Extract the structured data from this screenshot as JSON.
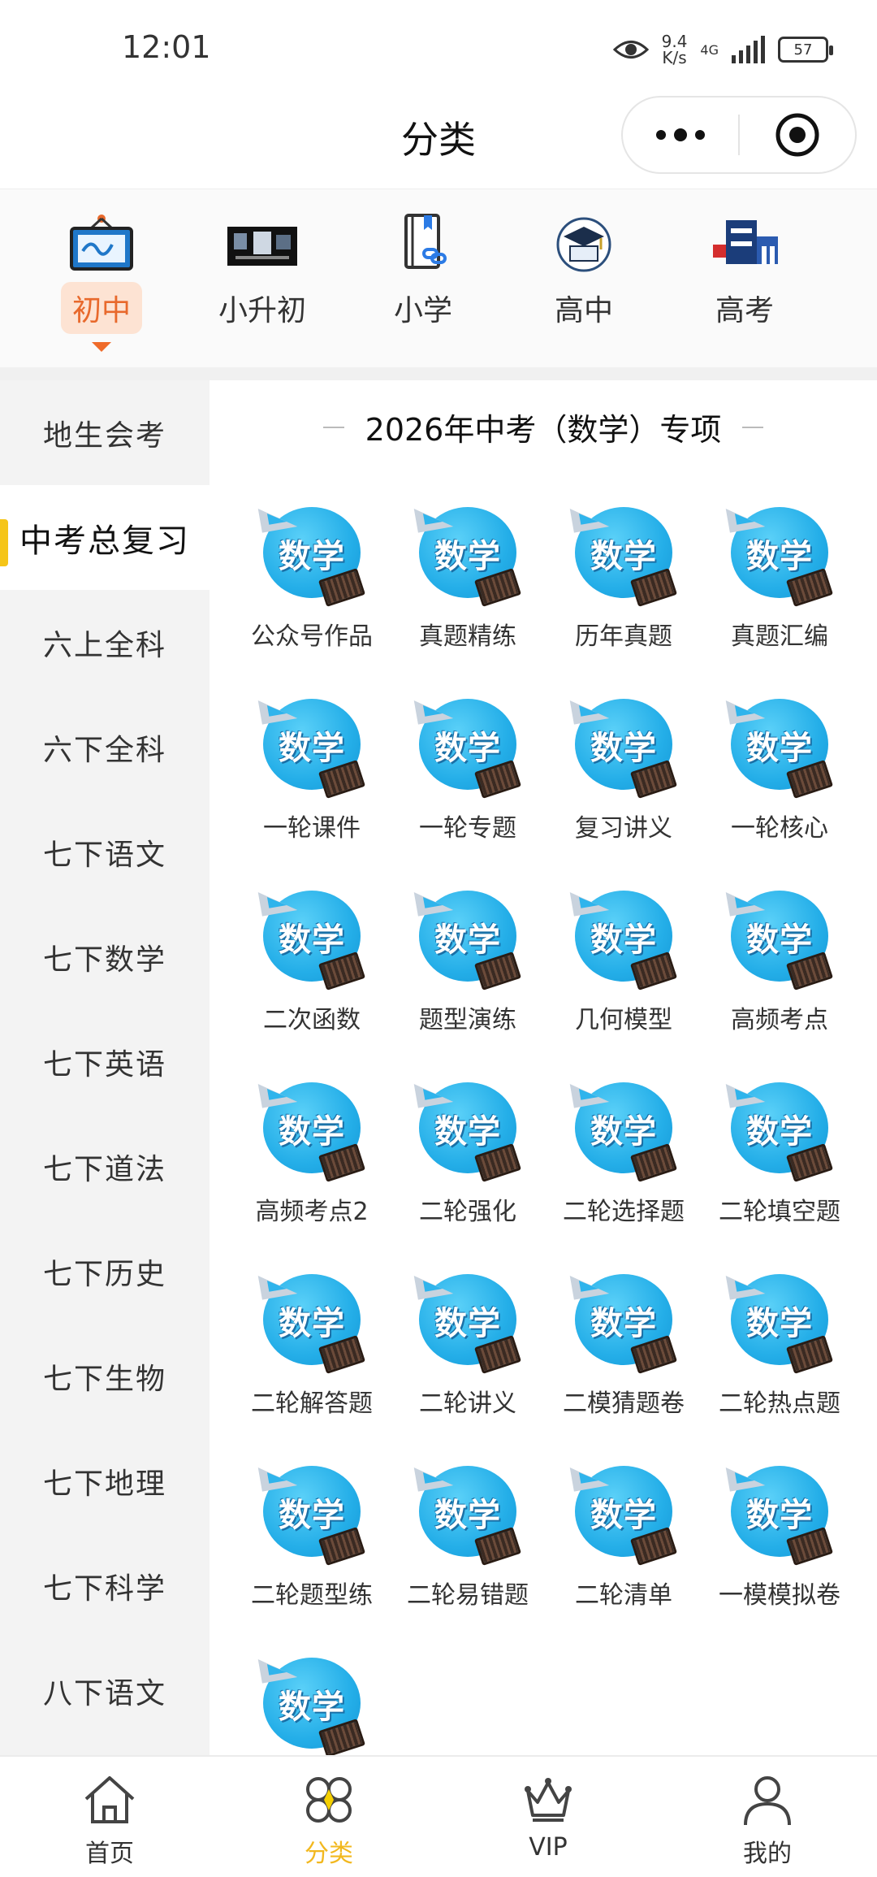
{
  "status_bar": {
    "time": "12:01",
    "net_speed_value": "9.4",
    "net_speed_unit": "K/s",
    "network_type": "4G",
    "battery": "57"
  },
  "header": {
    "title": "分类"
  },
  "levels": [
    {
      "label": "初中",
      "icon": "whiteboard-icon",
      "active": true
    },
    {
      "label": "小升初",
      "icon": "banner-image-icon",
      "active": false
    },
    {
      "label": "小学",
      "icon": "book-link-icon",
      "active": false
    },
    {
      "label": "高中",
      "icon": "graduation-cap-icon",
      "active": false
    },
    {
      "label": "高考",
      "icon": "gaokao-logo-icon",
      "active": false
    }
  ],
  "sidebar": {
    "items": [
      {
        "label": "地生会考"
      },
      {
        "label": "中考总复习",
        "active": true
      },
      {
        "label": "六上全科"
      },
      {
        "label": "六下全科"
      },
      {
        "label": "七下语文"
      },
      {
        "label": "七下数学"
      },
      {
        "label": "七下英语"
      },
      {
        "label": "七下道法"
      },
      {
        "label": "七下历史"
      },
      {
        "label": "七下生物"
      },
      {
        "label": "七下地理"
      },
      {
        "label": "七下科学"
      },
      {
        "label": "八下语文"
      }
    ]
  },
  "main": {
    "section_title": "2026年中考（数学）专项",
    "thumb_word": "数学",
    "items": [
      "公众号作品",
      "真题精练",
      "历年真题",
      "真题汇编",
      "一轮课件",
      "一轮专题",
      "复习讲义",
      "一轮核心",
      "二次函数",
      "题型演练",
      "几何模型",
      "高频考点",
      "高频考点2",
      "二轮强化",
      "二轮选择题",
      "二轮填空题",
      "二轮解答题",
      "二轮讲义",
      "二模猜题卷",
      "二轮热点题",
      "二轮题型练",
      "二轮易错题",
      "二轮清单",
      "一模模拟卷",
      ""
    ]
  },
  "bottom_nav": {
    "items": [
      {
        "label": "首页",
        "icon": "home-icon"
      },
      {
        "label": "分类",
        "icon": "category-icon",
        "active": true
      },
      {
        "label": "VIP",
        "icon": "crown-icon"
      },
      {
        "label": "我的",
        "icon": "user-icon"
      }
    ]
  },
  "colors": {
    "accent_orange": "#e8692c",
    "accent_yellow": "#f5c518",
    "nav_active": "#f2b81f"
  }
}
